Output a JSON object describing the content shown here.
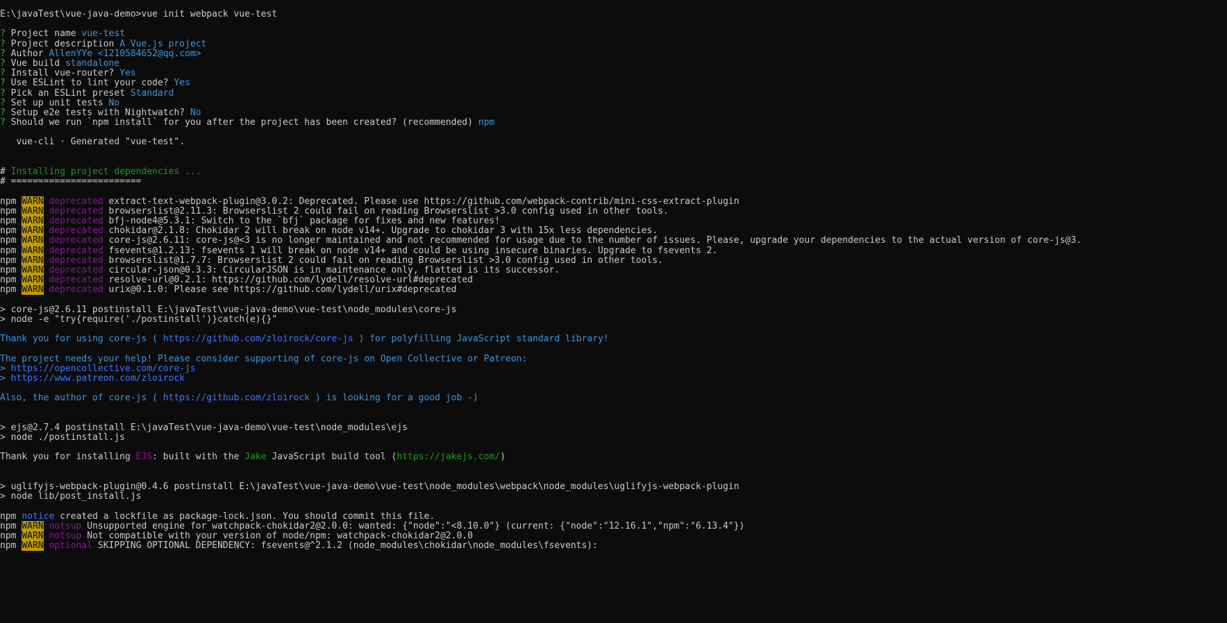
{
  "terminal": {
    "lines": [
      [
        [
          "E:\\javaTest\\vue-java-demo>vue init webpack vue-test",
          "default"
        ]
      ],
      [],
      [
        [
          "? ",
          "prompt-q"
        ],
        [
          "Project name ",
          "default"
        ],
        [
          "vue-test",
          "answer"
        ]
      ],
      [
        [
          "? ",
          "prompt-q"
        ],
        [
          "Project description ",
          "default"
        ],
        [
          "A Vue.js project",
          "answer"
        ]
      ],
      [
        [
          "? ",
          "prompt-q"
        ],
        [
          "Author ",
          "default"
        ],
        [
          "AllenYYe <1210584652@qq.com>",
          "answer"
        ]
      ],
      [
        [
          "? ",
          "prompt-q"
        ],
        [
          "Vue build ",
          "default"
        ],
        [
          "standalone",
          "answer"
        ]
      ],
      [
        [
          "? ",
          "prompt-q"
        ],
        [
          "Install vue-router? ",
          "default"
        ],
        [
          "Yes",
          "answer"
        ]
      ],
      [
        [
          "? ",
          "prompt-q"
        ],
        [
          "Use ESLint to lint your code? ",
          "default"
        ],
        [
          "Yes",
          "answer"
        ]
      ],
      [
        [
          "? ",
          "prompt-q"
        ],
        [
          "Pick an ESLint preset ",
          "default"
        ],
        [
          "Standard",
          "answer"
        ]
      ],
      [
        [
          "? ",
          "prompt-q"
        ],
        [
          "Set up unit tests ",
          "default"
        ],
        [
          "No",
          "answer"
        ]
      ],
      [
        [
          "? ",
          "prompt-q"
        ],
        [
          "Setup e2e tests with Nightwatch? ",
          "default"
        ],
        [
          "No",
          "answer"
        ]
      ],
      [
        [
          "? ",
          "prompt-q"
        ],
        [
          "Should we run `npm install` for you after the project has been created? (recommended) ",
          "default"
        ],
        [
          "npm",
          "answer"
        ]
      ],
      [],
      [
        [
          "   vue-cli · Generated \"vue-test\".",
          "default"
        ]
      ],
      [],
      [],
      [
        [
          "# ",
          "default"
        ],
        [
          "Installing project dependencies ...",
          "green"
        ]
      ],
      [
        [
          "# ========================",
          "default"
        ]
      ],
      [],
      [
        [
          "npm ",
          "default"
        ],
        [
          "WARN",
          "warn"
        ],
        [
          " ",
          "default"
        ],
        [
          "deprecated",
          "purple"
        ],
        [
          " extract-text-webpack-plugin@3.0.2: Deprecated. Please use https://github.com/webpack-contrib/mini-css-extract-plugin",
          "default"
        ]
      ],
      [
        [
          "npm ",
          "default"
        ],
        [
          "WARN",
          "warn"
        ],
        [
          " ",
          "default"
        ],
        [
          "deprecated",
          "purple"
        ],
        [
          " browserslist@2.11.3: Browserslist 2 could fail on reading Browserslist >3.0 config used in other tools.",
          "default"
        ]
      ],
      [
        [
          "npm ",
          "default"
        ],
        [
          "WARN",
          "warn"
        ],
        [
          " ",
          "default"
        ],
        [
          "deprecated",
          "purple"
        ],
        [
          " bfj-node4@5.3.1: Switch to the `bfj` package for fixes and new features!",
          "default"
        ]
      ],
      [
        [
          "npm ",
          "default"
        ],
        [
          "WARN",
          "warn"
        ],
        [
          " ",
          "default"
        ],
        [
          "deprecated",
          "purple"
        ],
        [
          " chokidar@2.1.8: Chokidar 2 will break on node v14+. Upgrade to chokidar 3 with 15x less dependencies.",
          "default"
        ]
      ],
      [
        [
          "npm ",
          "default"
        ],
        [
          "WARN",
          "warn"
        ],
        [
          " ",
          "default"
        ],
        [
          "deprecated",
          "purple"
        ],
        [
          " core-js@2.6.11: core-js@<3 is no longer maintained and not recommended for usage due to the number of issues. Please, upgrade your dependencies to the actual version of core-js@3.",
          "default"
        ]
      ],
      [
        [
          "npm ",
          "default"
        ],
        [
          "WARN",
          "warn"
        ],
        [
          " ",
          "default"
        ],
        [
          "deprecated",
          "purple"
        ],
        [
          " fsevents@1.2.13: fsevents 1 will break on node v14+ and could be using insecure binaries. Upgrade to fsevents 2.",
          "default"
        ]
      ],
      [
        [
          "npm ",
          "default"
        ],
        [
          "WARN",
          "warn"
        ],
        [
          " ",
          "default"
        ],
        [
          "deprecated",
          "purple"
        ],
        [
          " browserslist@1.7.7: Browserslist 2 could fail on reading Browserslist >3.0 config used in other tools.",
          "default"
        ]
      ],
      [
        [
          "npm ",
          "default"
        ],
        [
          "WARN",
          "warn"
        ],
        [
          " ",
          "default"
        ],
        [
          "deprecated",
          "purple"
        ],
        [
          " circular-json@0.3.3: CircularJSON is in maintenance only, flatted is its successor.",
          "default"
        ]
      ],
      [
        [
          "npm ",
          "default"
        ],
        [
          "WARN",
          "warn"
        ],
        [
          " ",
          "default"
        ],
        [
          "deprecated",
          "purple"
        ],
        [
          " resolve-url@0.2.1: https://github.com/lydell/resolve-url#deprecated",
          "default"
        ]
      ],
      [
        [
          "npm ",
          "default"
        ],
        [
          "WARN",
          "warn"
        ],
        [
          " ",
          "default"
        ],
        [
          "deprecated",
          "purple"
        ],
        [
          " urix@0.1.0: Please see https://github.com/lydell/urix#deprecated",
          "default"
        ]
      ],
      [],
      [
        [
          "> core-js@2.6.11 postinstall E:\\javaTest\\vue-java-demo\\vue-test\\node_modules\\core-js",
          "default"
        ]
      ],
      [
        [
          "> node -e \"try{require('./postinstall')}catch(e){}\"",
          "default"
        ]
      ],
      [],
      [
        [
          "Thank you for using core-js ( ",
          "cyan"
        ],
        [
          "https://github.com/zloirock/core-js",
          "link"
        ],
        [
          " ) for polyfilling JavaScript standard library!",
          "cyan"
        ]
      ],
      [],
      [
        [
          "The project needs your help! Please consider supporting of core-js on Open Collective or Patreon:",
          "cyan"
        ]
      ],
      [
        [
          "> ",
          "cyan"
        ],
        [
          "https://opencollective.com/core-js",
          "link"
        ]
      ],
      [
        [
          "> ",
          "cyan"
        ],
        [
          "https://www.patreon.com/zloirock",
          "link"
        ]
      ],
      [],
      [
        [
          "Also, the author of core-js ( ",
          "cyan"
        ],
        [
          "https://github.com/zloirock",
          "link"
        ],
        [
          " ) is looking for a good job -)",
          "cyan"
        ]
      ],
      [],
      [],
      [
        [
          "> ejs@2.7.4 postinstall E:\\javaTest\\vue-java-demo\\vue-test\\node_modules\\ejs",
          "default"
        ]
      ],
      [
        [
          "> node ./postinstall.js",
          "default"
        ]
      ],
      [],
      [
        [
          "Thank you for installing ",
          "default"
        ],
        [
          "EJS",
          "magenta"
        ],
        [
          ": built with the ",
          "default"
        ],
        [
          "Jake",
          "green"
        ],
        [
          " JavaScript build tool (",
          "default"
        ],
        [
          "https://jakejs.com/",
          "green"
        ],
        [
          ")",
          "default"
        ]
      ],
      [],
      [],
      [
        [
          "> uglifyjs-webpack-plugin@0.4.6 postinstall E:\\javaTest\\vue-java-demo\\vue-test\\node_modules\\webpack\\node_modules\\uglifyjs-webpack-plugin",
          "default"
        ]
      ],
      [
        [
          "> node lib/post_install.js",
          "default"
        ]
      ],
      [],
      [
        [
          "npm ",
          "default"
        ],
        [
          "notice",
          "notice"
        ],
        [
          " created a lockfile as package-lock.json. You should commit this file.",
          "default"
        ]
      ],
      [
        [
          "npm ",
          "default"
        ],
        [
          "WARN",
          "warn"
        ],
        [
          " ",
          "default"
        ],
        [
          "notsup",
          "purple"
        ],
        [
          " Unsupported engine for watchpack-chokidar2@2.0.0: wanted: {\"node\":\"<8.10.0\"} (current: {\"node\":\"12.16.1\",\"npm\":\"6.13.4\"})",
          "default"
        ]
      ],
      [
        [
          "npm ",
          "default"
        ],
        [
          "WARN",
          "warn"
        ],
        [
          " ",
          "default"
        ],
        [
          "notsup",
          "purple"
        ],
        [
          " Not compatible with your version of node/npm: watchpack-chokidar2@2.0.0",
          "default"
        ]
      ],
      [
        [
          "npm ",
          "default"
        ],
        [
          "WARN",
          "warn"
        ],
        [
          " ",
          "default"
        ],
        [
          "optional",
          "purple"
        ],
        [
          " SKIPPING OPTIONAL DEPENDENCY: fsevents@^2.1.2 (node_modules\\chokidar\\node_modules\\fsevents):",
          "default"
        ]
      ]
    ]
  }
}
